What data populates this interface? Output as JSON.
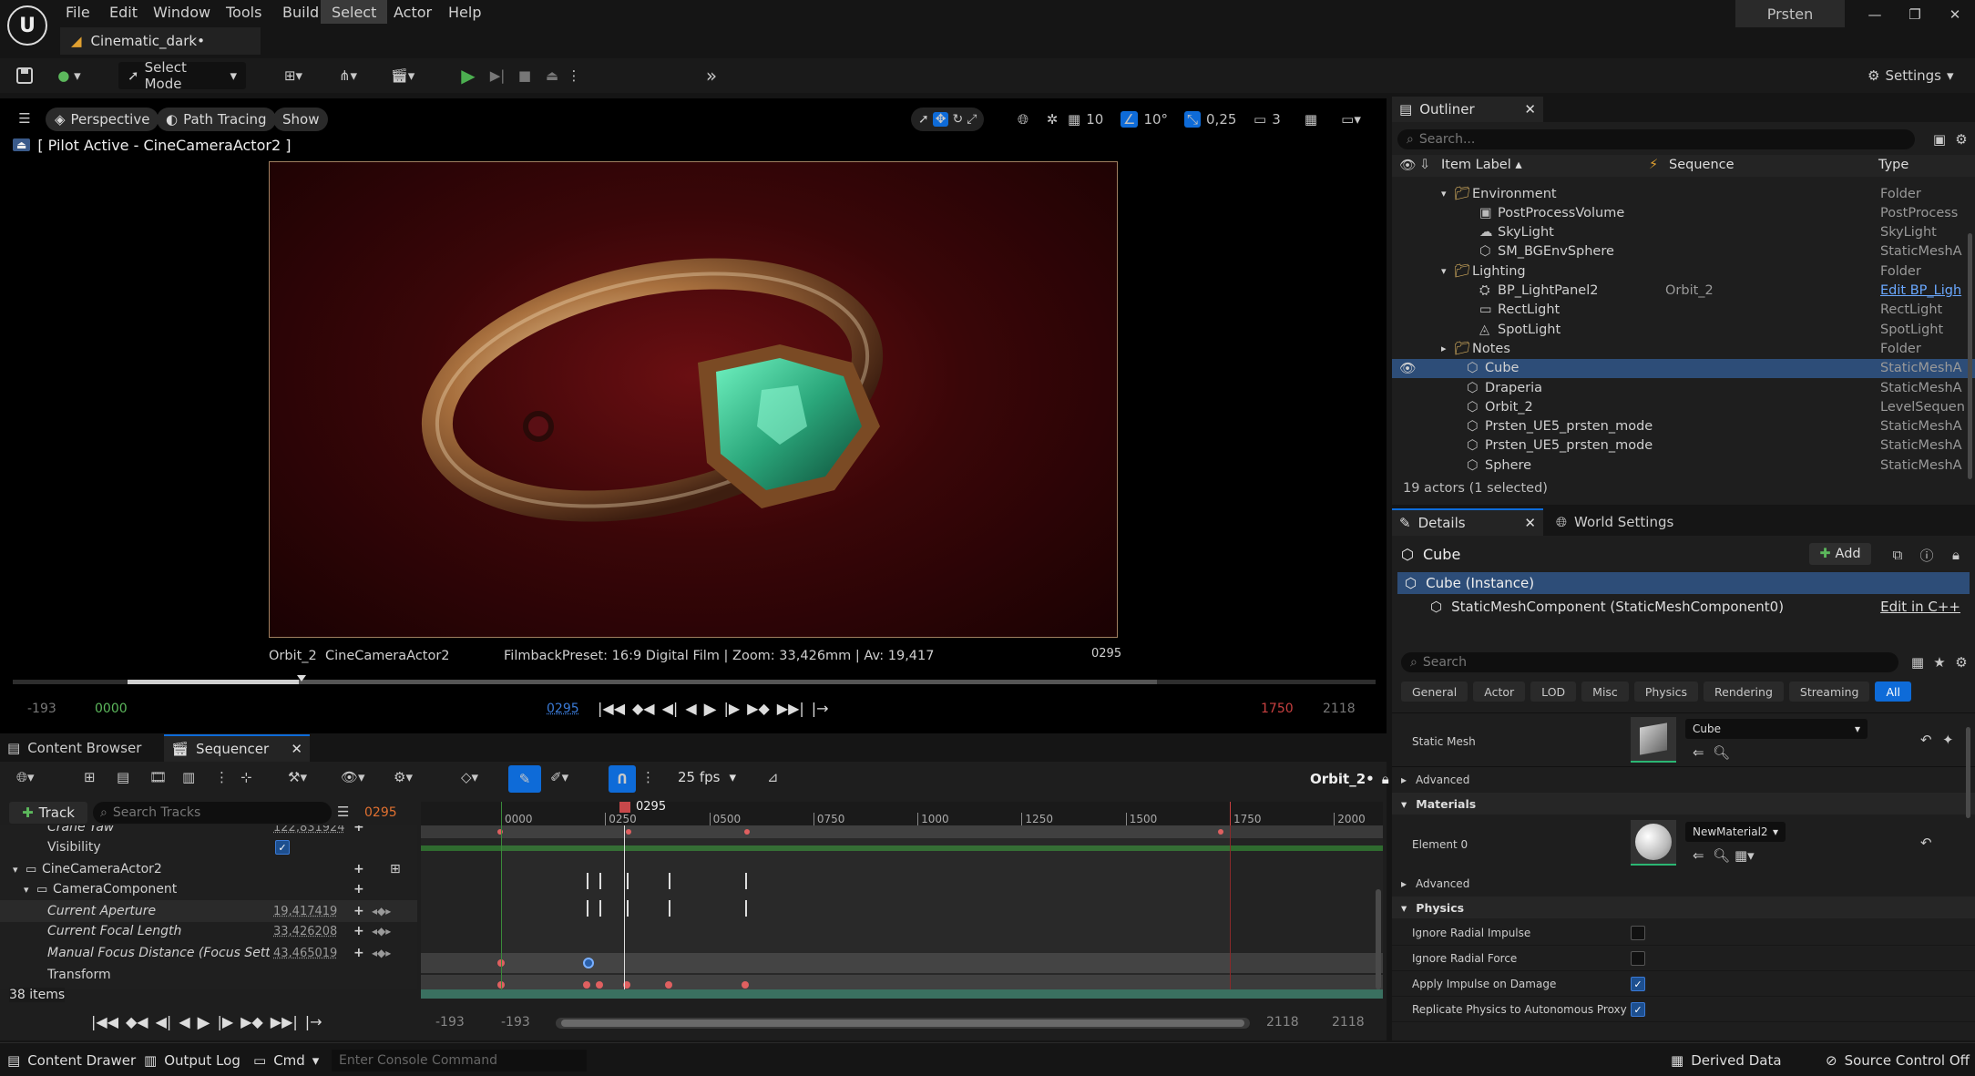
{
  "app": {
    "project_tab": "Cinematic_dark•",
    "user": "Prsten"
  },
  "menu": [
    "File",
    "Edit",
    "Window",
    "Tools",
    "Build",
    "Select",
    "Actor",
    "Help"
  ],
  "toolbar": {
    "select_mode": "Select Mode",
    "settings": "Settings"
  },
  "viewport": {
    "perspective": "Perspective",
    "path_tracing": "Path Tracing",
    "show": "Show",
    "pilot": "[ Pilot Active - CineCameraActor2 ]",
    "grid": "10",
    "angle": "10°",
    "scale": "0,25",
    "camera_speed": "3",
    "camera_label": "Orbit_2  CineCameraActor2",
    "filmback": "FilmbackPreset: 16:9 Digital Film | Zoom: 33,426mm | Av: 19,417",
    "frame_overlay": "0295",
    "t_left1": "-193",
    "t_start": "0000",
    "t_current": "0295",
    "t_end": "1750",
    "t_right": "2118"
  },
  "outliner": {
    "title": "Outliner",
    "search_placeholder": "Search...",
    "col_label": "Item Label",
    "col_sequence": "Sequence",
    "col_type": "Type",
    "items": [
      {
        "label": "Environment",
        "type": "Folder",
        "seq": ""
      },
      {
        "label": "PostProcessVolume",
        "type": "PostProcess",
        "seq": ""
      },
      {
        "label": "SkyLight",
        "type": "SkyLight",
        "seq": ""
      },
      {
        "label": "SM_BGEnvSphere",
        "type": "StaticMeshA",
        "seq": ""
      },
      {
        "label": "Lighting",
        "type": "Folder",
        "seq": ""
      },
      {
        "label": "BP_LightPanel2",
        "type": "Edit BP_Ligh",
        "seq": "Orbit_2"
      },
      {
        "label": "RectLight",
        "type": "RectLight",
        "seq": ""
      },
      {
        "label": "SpotLight",
        "type": "SpotLight",
        "seq": ""
      },
      {
        "label": "Notes",
        "type": "Folder",
        "seq": ""
      },
      {
        "label": "Cube",
        "type": "StaticMeshA",
        "seq": ""
      },
      {
        "label": "Draperia",
        "type": "StaticMeshA",
        "seq": ""
      },
      {
        "label": "Orbit_2",
        "type": "LevelSequen",
        "seq": ""
      },
      {
        "label": "Prsten_UE5_prsten_mode",
        "type": "StaticMeshA",
        "seq": ""
      },
      {
        "label": "Prsten_UE5_prsten_mode",
        "type": "StaticMeshA",
        "seq": ""
      },
      {
        "label": "Sphere",
        "type": "StaticMeshA",
        "seq": ""
      }
    ],
    "status": "19 actors (1 selected)"
  },
  "details": {
    "tab": "Details",
    "world_settings": "World Settings",
    "object": "Cube",
    "add": "Add",
    "instance": "Cube (Instance)",
    "component": "StaticMeshComponent (StaticMeshComponent0)",
    "edit_cpp": "Edit in C++",
    "search_placeholder": "Search",
    "filters": [
      "General",
      "Actor",
      "LOD",
      "Misc",
      "Physics",
      "Rendering",
      "Streaming",
      "All"
    ],
    "static_mesh_label": "Static Mesh",
    "static_mesh_value": "Cube",
    "advanced": "Advanced",
    "materials": "Materials",
    "element0": "Element 0",
    "material_value": "NewMaterial2",
    "physics": "Physics",
    "physics_props": [
      {
        "label": "Ignore Radial Impulse",
        "checked": false
      },
      {
        "label": "Ignore Radial Force",
        "checked": false
      },
      {
        "label": "Apply Impulse on Damage",
        "checked": true
      },
      {
        "label": "Replicate Physics to Autonomous Proxy",
        "checked": true
      }
    ]
  },
  "bottom_tabs": {
    "content_browser": "Content Browser",
    "sequencer": "Sequencer"
  },
  "sequencer": {
    "fps": "25 fps",
    "sequence_name": "Orbit_2•",
    "add_track": "Track",
    "search_placeholder": "Search Tracks",
    "current_frame": "0295",
    "ruler": [
      "0000",
      "0250",
      "0500",
      "0750",
      "1000",
      "1250",
      "1500",
      "1750",
      "2000"
    ],
    "playhead_label": "0295",
    "tracks": [
      {
        "label": "Crane Yaw",
        "value": "122,831924"
      },
      {
        "label": "Visibility",
        "value": ""
      },
      {
        "label": "CineCameraActor2",
        "value": ""
      },
      {
        "label": "CameraComponent",
        "value": ""
      },
      {
        "label": "Current Aperture",
        "value": "19,417419"
      },
      {
        "label": "Current Focal Length",
        "value": "33,426208"
      },
      {
        "label": "Manual Focus Distance (Focus Settin",
        "value": "43,465019"
      },
      {
        "label": "Transform",
        "value": ""
      }
    ],
    "items_count": "38 items",
    "bottom_left1": "-193",
    "bottom_left2": "-193",
    "bottom_right1": "2118",
    "bottom_right2": "2118"
  },
  "statusbar": {
    "content_drawer": "Content Drawer",
    "output_log": "Output Log",
    "cmd": "Cmd",
    "console_placeholder": "Enter Console Command",
    "derived_data": "Derived Data",
    "source_control": "Source Control Off"
  }
}
